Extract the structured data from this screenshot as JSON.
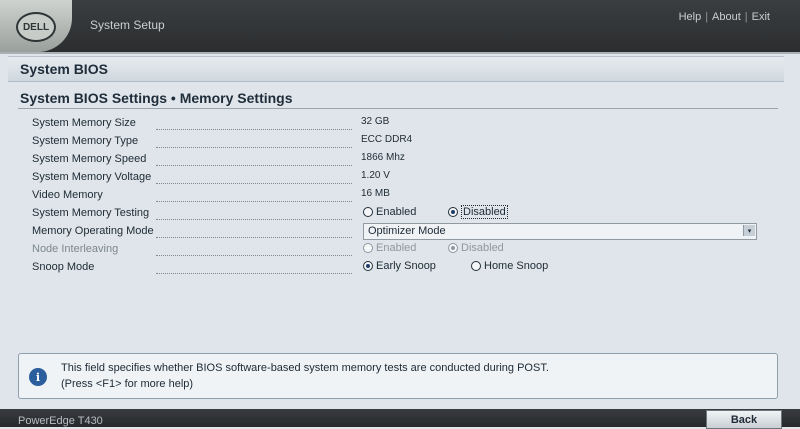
{
  "header": {
    "logo_text": "DELL",
    "app_title": "System Setup",
    "links": [
      "Help",
      "About",
      "Exit"
    ]
  },
  "banner": {
    "title": "System BIOS"
  },
  "page": {
    "title": "System BIOS Settings • Memory Settings",
    "rows": [
      {
        "label": "System Memory Size",
        "value": "32 GB"
      },
      {
        "label": "System Memory Type",
        "value": "ECC DDR4"
      },
      {
        "label": "System Memory Speed",
        "value": "1866 Mhz"
      },
      {
        "label": "System Memory Voltage",
        "value": "1.20 V"
      },
      {
        "label": "Video Memory",
        "value": "16 MB"
      },
      {
        "label": "System Memory Testing",
        "options": [
          "Enabled",
          "Disabled"
        ],
        "selected": "Disabled"
      },
      {
        "label": "Memory Operating Mode",
        "select_value": "Optimizer Mode"
      },
      {
        "label": "Node Interleaving",
        "options": [
          "Enabled",
          "Disabled"
        ],
        "selected": "Disabled",
        "disabled": true
      },
      {
        "label": "Snoop Mode",
        "options": [
          "Early Snoop",
          "Home Snoop"
        ],
        "selected": "Early Snoop"
      }
    ]
  },
  "help": {
    "text": "This field specifies whether BIOS software-based system memory tests are conducted during POST. (Press <F1> for more help)"
  },
  "footer": {
    "model": "PowerEdge T430",
    "back_label": "Back"
  }
}
